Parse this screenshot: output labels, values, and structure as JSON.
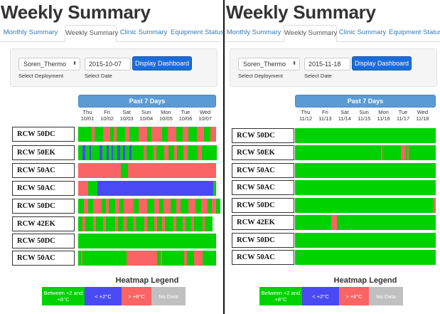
{
  "colors": {
    "between": "#00d200",
    "cold": "#4a4af5",
    "hot": "#fa6464",
    "nodata": "#c0c0c0",
    "tick_green": "#1e8e1e",
    "tick_red": "#cc3333"
  },
  "panels": [
    {
      "title": "Weekly Summary",
      "tabs": [
        {
          "label": "Monthly Summary",
          "active": false
        },
        {
          "label": "Weekly Summary",
          "active": true
        },
        {
          "label": "Clinic Summary",
          "active": false
        },
        {
          "label": "Equipment Status",
          "active": false
        }
      ],
      "deployment": {
        "value": "Soren_Thermo",
        "label": "Select Deployment"
      },
      "date": {
        "value": "2015-10-07",
        "label": "Select Date"
      },
      "button_label": "Display Dashboard",
      "past_label": "Past 7 Days",
      "days": [
        {
          "dow": "Thu",
          "date": "10/01"
        },
        {
          "dow": "Fri",
          "date": "10/02"
        },
        {
          "dow": "Sat",
          "date": "10/03"
        },
        {
          "dow": "Sun",
          "date": "10/04"
        },
        {
          "dow": "Mon",
          "date": "10/05"
        },
        {
          "dow": "Tue",
          "date": "10/06"
        },
        {
          "dow": "Wed",
          "date": "10/07"
        }
      ],
      "rows": [
        {
          "label": "RCW 50DC",
          "segments": [
            [
              "between",
              0.1
            ],
            [
              "hot",
              0.02
            ],
            [
              "between",
              0.06
            ],
            [
              "hot",
              0.05
            ],
            [
              "between",
              0.03
            ],
            [
              "hot",
              0.02
            ],
            [
              "between",
              0.06
            ],
            [
              "hot",
              0.03
            ],
            [
              "between",
              0.07
            ],
            [
              "hot",
              0.06
            ],
            [
              "between",
              0.03
            ],
            [
              "hot",
              0.08
            ],
            [
              "between",
              0.04
            ],
            [
              "hot",
              0.06
            ],
            [
              "between",
              0.05
            ],
            [
              "hot",
              0.04
            ],
            [
              "between",
              0.06
            ],
            [
              "hot",
              0.05
            ],
            [
              "between",
              0.05
            ],
            [
              "hot",
              0.04
            ]
          ]
        },
        {
          "label": "RCW 50EK",
          "segments": [
            [
              "between",
              0.03
            ],
            [
              "cold",
              0.02
            ],
            [
              "between",
              0.03
            ],
            [
              "cold",
              0.015
            ],
            [
              "between",
              0.06
            ],
            [
              "cold",
              0.02
            ],
            [
              "between",
              0.03
            ],
            [
              "cold",
              0.015
            ],
            [
              "between",
              0.02
            ],
            [
              "cold",
              0.015
            ],
            [
              "between",
              0.03
            ],
            [
              "cold",
              0.02
            ],
            [
              "between",
              0.02
            ],
            [
              "cold",
              0.015
            ],
            [
              "between",
              0.03
            ],
            [
              "cold",
              0.015
            ],
            [
              "between",
              0.09
            ],
            [
              "hot",
              0.02
            ],
            [
              "between",
              0.05
            ],
            [
              "hot",
              0.02
            ],
            [
              "between",
              0.06
            ],
            [
              "hot",
              0.03
            ],
            [
              "between",
              0.04
            ],
            [
              "hot",
              0.02
            ],
            [
              "between",
              0.05
            ],
            [
              "hot",
              0.03
            ],
            [
              "between",
              0.07
            ],
            [
              "hot",
              0.03
            ],
            [
              "between",
              0.11
            ]
          ]
        },
        {
          "label": "RCW 50AC",
          "segments": [
            [
              "hot",
              0.31
            ],
            [
              "between",
              0.05
            ],
            [
              "hot",
              0.64
            ]
          ]
        },
        {
          "label": "RCW 50AC",
          "segments": [
            [
              "hot",
              0.07
            ],
            [
              "between",
              0.07
            ],
            [
              "cold",
              0.84
            ],
            [
              "between",
              0.02
            ]
          ]
        },
        {
          "label": "RCW 50DC",
          "segments": [
            [
              "between",
              0.04
            ],
            [
              "hot",
              0.03
            ],
            [
              "between",
              0.04
            ],
            [
              "hot",
              0.06
            ],
            [
              "between",
              0.03
            ],
            [
              "hot",
              0.02
            ],
            [
              "between",
              0.05
            ],
            [
              "hot",
              0.03
            ],
            [
              "between",
              0.03
            ],
            [
              "hot",
              0.07
            ],
            [
              "between",
              0.04
            ],
            [
              "hot",
              0.06
            ],
            [
              "between",
              0.05
            ],
            [
              "hot",
              0.04
            ],
            [
              "between",
              0.03
            ],
            [
              "hot",
              0.05
            ],
            [
              "between",
              0.04
            ],
            [
              "hot",
              0.03
            ],
            [
              "between",
              0.06
            ],
            [
              "hot",
              0.05
            ],
            [
              "between",
              0.04
            ],
            [
              "hot",
              0.05
            ],
            [
              "between",
              0.03
            ],
            [
              "hot",
              0.03
            ],
            [
              "between",
              0.03
            ]
          ]
        },
        {
          "label": "RCW 42EK",
          "segments": [
            [
              "between",
              0.03
            ],
            [
              "hot",
              0.02
            ],
            [
              "between",
              0.06
            ],
            [
              "hot",
              0.02
            ],
            [
              "between",
              0.05
            ],
            [
              "hot",
              0.02
            ],
            [
              "between",
              0.07
            ],
            [
              "hot",
              0.02
            ],
            [
              "between",
              0.04
            ],
            [
              "hot",
              0.02
            ],
            [
              "between",
              0.05
            ],
            [
              "hot",
              0.02
            ],
            [
              "between",
              0.06
            ],
            [
              "hot",
              0.02
            ],
            [
              "between",
              0.05
            ],
            [
              "hot",
              0.02
            ],
            [
              "between",
              0.04
            ],
            [
              "hot",
              0.02
            ],
            [
              "between",
              0.06
            ],
            [
              "hot",
              0.02
            ],
            [
              "between",
              0.05
            ],
            [
              "hot",
              0.02
            ],
            [
              "between",
              0.04
            ],
            [
              "hot",
              0.02
            ],
            [
              "between",
              0.06
            ],
            [
              "hot",
              0.02
            ],
            [
              "between",
              0.05
            ]
          ]
        },
        {
          "label": "RCW 50DC",
          "segments": [
            [
              "between",
              1.0
            ]
          ]
        },
        {
          "label": "RCW 50AC",
          "segments": [
            [
              "between",
              0.02
            ],
            [
              "hot",
              0.01
            ],
            [
              "between",
              0.32
            ],
            [
              "hot",
              0.22
            ],
            [
              "between",
              0.03
            ],
            [
              "hot",
              0.01
            ],
            [
              "between",
              0.16
            ],
            [
              "hot",
              0.02
            ],
            [
              "between",
              0.05
            ],
            [
              "hot",
              0.06
            ],
            [
              "between",
              0.1
            ]
          ]
        }
      ],
      "legend": {
        "title": "Heatmap Legend",
        "between": "Between +2 and +8°C",
        "cold": "< +2°C",
        "hot": "> +8°C",
        "nodata": "No Data"
      }
    },
    {
      "title": "Weekly Summary",
      "tabs": [
        {
          "label": "Monthly Summary",
          "active": false
        },
        {
          "label": "Weekly Summary",
          "active": true
        },
        {
          "label": "Clinic Summary",
          "active": false
        },
        {
          "label": "Equipment Status",
          "active": false
        }
      ],
      "deployment": {
        "value": "Soren_Thermo",
        "label": "Select Deployment"
      },
      "date": {
        "value": "2015-11-18",
        "label": "Select Date"
      },
      "button_label": "Display Dashboard",
      "past_label": "Past 7 Days",
      "days": [
        {
          "dow": "Thu",
          "date": "11/12"
        },
        {
          "dow": "Fri",
          "date": "11/13"
        },
        {
          "dow": "Sat",
          "date": "11/14"
        },
        {
          "dow": "Sun",
          "date": "11/15"
        },
        {
          "dow": "Mon",
          "date": "11/16"
        },
        {
          "dow": "Tue",
          "date": "11/17"
        },
        {
          "dow": "Wed",
          "date": "11/18"
        }
      ],
      "rows": [
        {
          "label": "RCW 50DC",
          "segments": [
            [
              "between",
              1.0
            ]
          ]
        },
        {
          "label": "RCW 50EK",
          "segments": [
            [
              "between",
              0.61
            ],
            [
              "hot",
              0.01
            ],
            [
              "between",
              0.13
            ],
            [
              "hot",
              0.04
            ],
            [
              "between",
              0.01
            ],
            [
              "hot",
              0.01
            ],
            [
              "between",
              0.19
            ]
          ]
        },
        {
          "label": "RCW 50AC",
          "segments": [
            [
              "between",
              1.0
            ]
          ]
        },
        {
          "label": "RCW 50AC",
          "segments": [
            [
              "between",
              1.0
            ]
          ]
        },
        {
          "label": "RCW 50DC",
          "segments": [
            [
              "between",
              0.985
            ],
            [
              "hot",
              0.015
            ]
          ]
        },
        {
          "label": "RCW 42EK",
          "segments": [
            [
              "between",
              0.26
            ],
            [
              "hot",
              0.04
            ],
            [
              "between",
              0.7
            ]
          ]
        },
        {
          "label": "RCW 50DC",
          "segments": [
            [
              "between",
              1.0
            ]
          ]
        },
        {
          "label": "RCW 50AC",
          "segments": [
            [
              "between",
              1.0
            ]
          ]
        }
      ],
      "legend": {
        "title": "Heatmap Legend",
        "between": "Between +2 and +8°C",
        "cold": "< +2°C",
        "hot": "> +8°C",
        "nodata": "No Data"
      }
    }
  ]
}
